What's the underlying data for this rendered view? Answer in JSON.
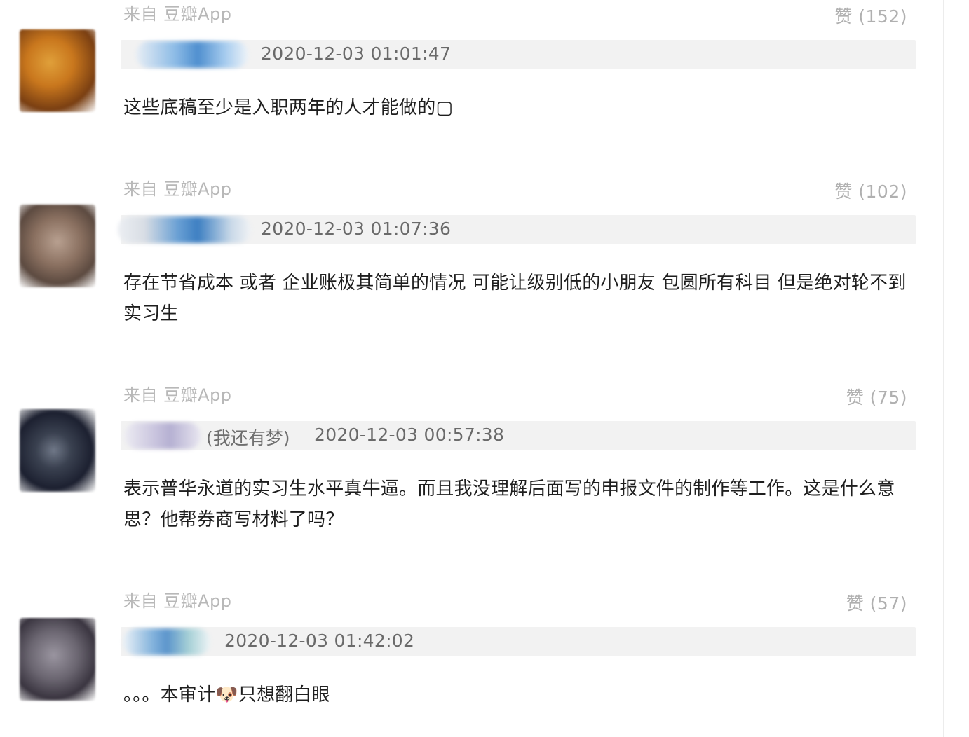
{
  "comments": [
    {
      "source": "来自 豆瓣App",
      "likes": "赞 (152)",
      "nickname": "",
      "time": "2020-12-03 01:01:47",
      "text": "这些底稿至少是入职两年的人才能做的▢",
      "avatar_colors": [
        "#c9771d",
        "#7a3f12",
        "#e0a03a"
      ]
    },
    {
      "source": "来自 豆瓣App",
      "likes": "赞 (102)",
      "nickname": "",
      "time": "2020-12-03 01:07:36",
      "text": "存在节省成本 或者 企业账极其简单的情况 可能让级别低的小朋友 包圆所有科目 但是绝对轮不到实习生",
      "avatar_colors": [
        "#8a7060",
        "#5c4a40",
        "#b8a090"
      ]
    },
    {
      "source": "来自 豆瓣App",
      "likes": "赞 (75)",
      "nickname": "(我还有梦)",
      "time": "2020-12-03 00:57:38",
      "text": "表示普华永道的实习生水平真牛逼。而且我没理解后面写的申报文件的制作等工作。这是什么意思？他帮券商写材料了吗？",
      "avatar_colors": [
        "#1c2030",
        "#3a4150",
        "#707888"
      ]
    },
    {
      "source": "来自 豆瓣App",
      "likes": "赞 (57)",
      "nickname": "",
      "time": "2020-12-03 01:42:02",
      "text": "。。。本审计🐶只想翻白眼",
      "avatar_colors": [
        "#6a6570",
        "#3a3540",
        "#9a95a0"
      ]
    }
  ],
  "colors": {
    "meta_bar": "#f2f2f2",
    "muted_text": "#b8b8b8",
    "time_text": "#6a6a6a",
    "body_text": "#1e1e1e",
    "name_blur": "#6aa6d8"
  }
}
